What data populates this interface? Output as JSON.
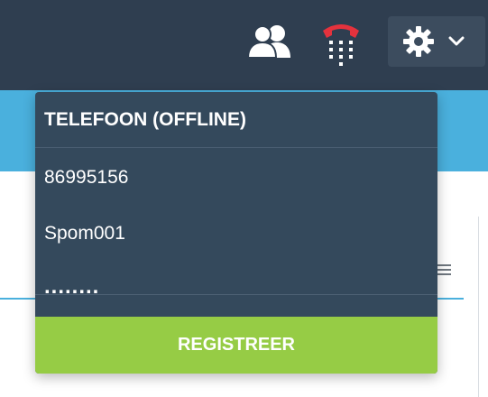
{
  "topbar": {
    "contacts_icon": "contacts-icon",
    "phone_icon": "phone-icon",
    "settings_icon": "gear-icon",
    "settings_chevron": "chevron-down-icon"
  },
  "dropdown": {
    "header": "TELEFOON (OFFLINE)",
    "number": "86995156",
    "username": "Spom001",
    "password_masked": "........",
    "register_label": "REGISTREER"
  },
  "colors": {
    "topbar": "#2f3e50",
    "accent_blue": "#4ab0dd",
    "dropdown_bg": "#34495c",
    "register_green": "#96cc45",
    "phone_red": "#e5323d"
  }
}
